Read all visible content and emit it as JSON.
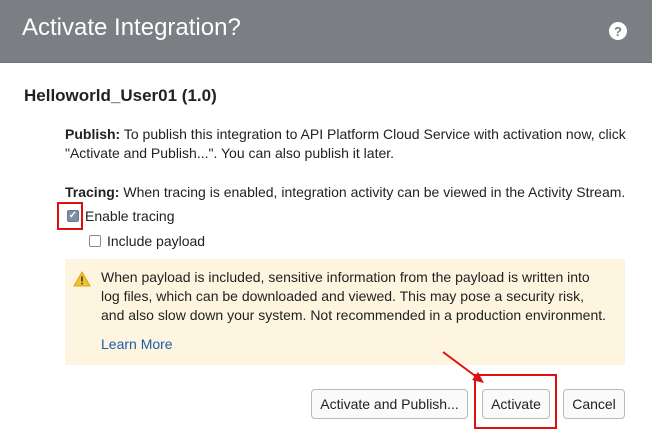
{
  "dialog": {
    "title": "Activate Integration?",
    "help_icon": "?",
    "integration_name": "Helloworld_User01 (1.0)"
  },
  "publish": {
    "label": "Publish:",
    "text": " To publish this integration to API Platform Cloud Service with activation now, click \"Activate and Publish...\". You can also publish it later."
  },
  "tracing": {
    "label": "Tracing:",
    "text": " When tracing is enabled, integration activity can be viewed in the Activity Stream.",
    "enable_label": "Enable tracing",
    "enable_checked": true,
    "payload_label": "Include payload",
    "payload_checked": false
  },
  "warning": {
    "icon": "warning-icon",
    "text": "When payload is included, sensitive information from the payload is written into log files, which can be downloaded and viewed. This may pose a security risk, and also slow down your system. Not recommended in a production environment.",
    "link": "Learn More"
  },
  "buttons": {
    "publish": "Activate and Publish...",
    "activate": "Activate",
    "cancel": "Cancel"
  },
  "colors": {
    "titlebar": "#7b7e82",
    "warning_bg": "#fdf5df",
    "highlight": "#e01010",
    "link": "#1a5ea8"
  }
}
